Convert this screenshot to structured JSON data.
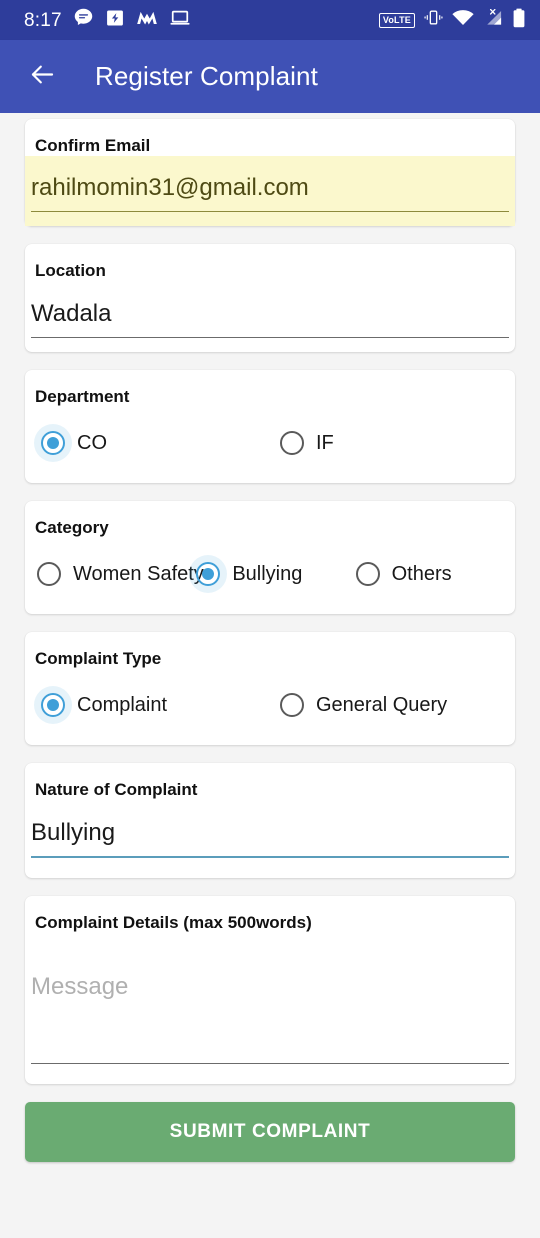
{
  "status_bar": {
    "time": "8:17",
    "background_color": "#2E3D9B",
    "left_icons": [
      "messages-icon",
      "calendar-event-icon",
      "monzo-app-icon",
      "laptop-icon"
    ],
    "right_icons": [
      "volte-icon",
      "vibrate-icon",
      "wifi-icon",
      "cellular-signal-no-sim-icon",
      "battery-icon"
    ],
    "volte_label": "VoLTE"
  },
  "app_bar": {
    "title": "Register Complaint",
    "back_icon": "arrow-left-icon",
    "background_color": "#3F51B5",
    "text_color": "#FFFFFF"
  },
  "form": {
    "confirm_email": {
      "label": "Confirm Email",
      "value": "rahilmomin31@gmail.com",
      "placeholder": "Confirm Email",
      "autofilled": true,
      "autofill_color": "#FBF8CD"
    },
    "location": {
      "label": "Location",
      "value": "Wadala",
      "placeholder": "Location"
    },
    "department": {
      "label": "Department",
      "options": [
        {
          "label": "CO",
          "selected": true
        },
        {
          "label": "IF",
          "selected": false
        }
      ]
    },
    "category": {
      "label": "Category",
      "options": [
        {
          "label": "Women Safety",
          "selected": false
        },
        {
          "label": "Bullying",
          "selected": true
        },
        {
          "label": "Others",
          "selected": false
        }
      ]
    },
    "complaint_type": {
      "label": "Complaint Type",
      "options": [
        {
          "label": "Complaint",
          "selected": true
        },
        {
          "label": "General Query",
          "selected": false
        }
      ]
    },
    "nature_of_complaint": {
      "label": "Nature of Complaint",
      "value": "Bullying",
      "placeholder": "Nature of Complaint",
      "focused": true,
      "focus_color": "#5B9DBB"
    },
    "complaint_details": {
      "label": "Complaint Details (max 500words)",
      "value": "",
      "placeholder": "Message"
    },
    "submit": {
      "label": "SUBMIT COMPLAINT",
      "color": "#6AAB72"
    }
  },
  "theme": {
    "page_background": "#F4F4F4",
    "card_background": "#FFFFFF",
    "radio_selected_color": "#3F9FD8",
    "radio_unselected_color": "#5A5A5A"
  }
}
